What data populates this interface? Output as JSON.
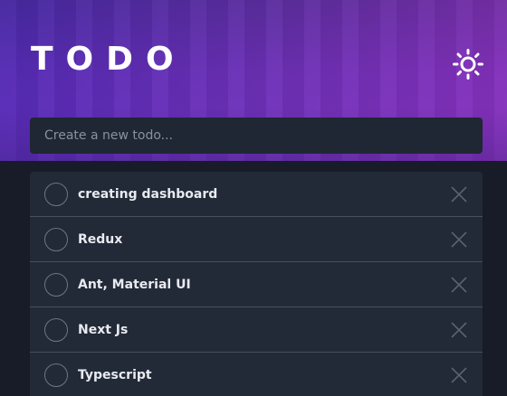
{
  "header": {
    "title": "TODO",
    "theme_icon": "sun-icon"
  },
  "new_todo": {
    "placeholder": "Create a new todo..."
  },
  "todos": [
    {
      "label": "creating dashboard",
      "completed": false
    },
    {
      "label": "Redux",
      "completed": false
    },
    {
      "label": "Ant, Material UI",
      "completed": false
    },
    {
      "label": "Next Js",
      "completed": false
    },
    {
      "label": "Typescript",
      "completed": false
    }
  ],
  "colors": {
    "page_background": "#171c28",
    "card_background": "#222a37",
    "text": "#e8eaf0",
    "accent_gradient_start": "#5028be",
    "accent_gradient_end": "#a032c8"
  }
}
